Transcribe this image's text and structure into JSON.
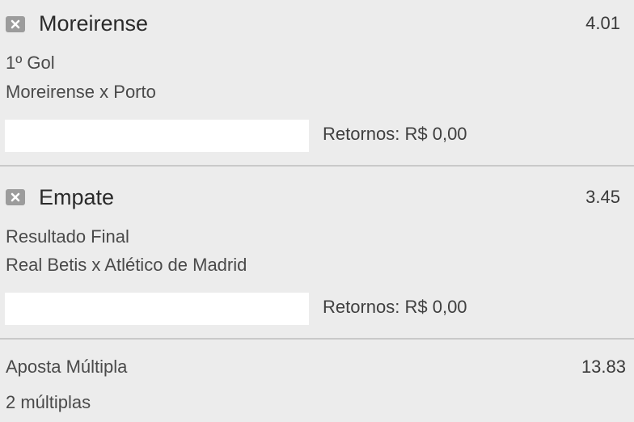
{
  "bets": [
    {
      "selection": "Moreirense",
      "odds": "4.01",
      "market": "1º Gol",
      "event": "Moreirense x Porto",
      "stake_value": "",
      "returns_label": "Retornos: R$ 0,00"
    },
    {
      "selection": "Empate",
      "odds": "3.45",
      "market": "Resultado Final",
      "event": "Real Betis x Atlético de Madrid",
      "stake_value": "",
      "returns_label": "Retornos: R$ 0,00"
    }
  ],
  "multiple": {
    "title": "Aposta Múltipla",
    "odds": "13.83",
    "count": "2 múltiplas"
  },
  "colors": {
    "background": "#ececec",
    "remove_button": "#9c9c9c",
    "divider": "#c9c9c9",
    "input_background": "#ffffff"
  },
  "icons": {
    "remove": "close-icon"
  }
}
